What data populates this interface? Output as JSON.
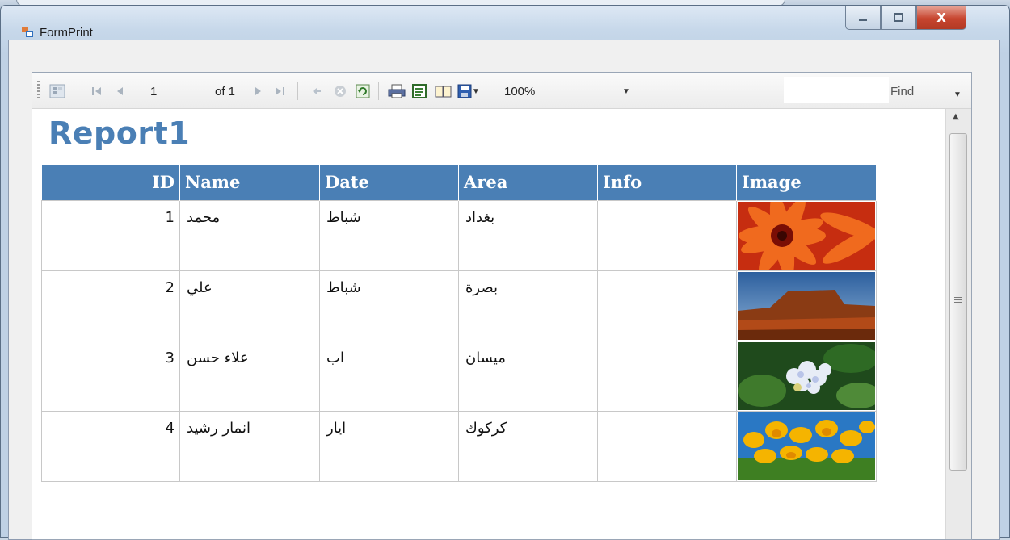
{
  "window": {
    "title": "FormPrint",
    "minimize": "–",
    "maximize": "□",
    "close": "X"
  },
  "toolbar": {
    "page_current": "1",
    "page_of": "of 1",
    "zoom": "100%",
    "find_placeholder": "",
    "find_label": "Find",
    "icons": [
      "parameters-icon",
      "first-page-icon",
      "previous-page-icon",
      "next-page-icon",
      "last-page-icon",
      "back-icon",
      "stop-icon",
      "refresh-icon",
      "print-icon",
      "print-layout-icon",
      "page-setup-icon",
      "export-icon"
    ]
  },
  "report": {
    "title": "Report1",
    "columns": [
      "ID",
      "Name",
      "Date",
      "Area",
      "Info",
      "Image"
    ],
    "rows": [
      {
        "id": "1",
        "name": "محمد",
        "date": "شباط",
        "area": "بغداد",
        "info": "",
        "image": "red-flower-photo"
      },
      {
        "id": "2",
        "name": "علي",
        "date": "شباط",
        "area": "بصرة",
        "info": "",
        "image": "desert-mesa-photo"
      },
      {
        "id": "3",
        "name": "علاء حسن",
        "date": "اب",
        "area": "ميسان",
        "info": "",
        "image": "hydrangea-photo"
      },
      {
        "id": "4",
        "name": "انمار رشيد",
        "date": "ايار",
        "area": "كركوك",
        "info": "",
        "image": "tulips-photo"
      }
    ]
  },
  "colors": {
    "header_bg": "#4a7fb5",
    "title_color": "#4a7fb5"
  }
}
